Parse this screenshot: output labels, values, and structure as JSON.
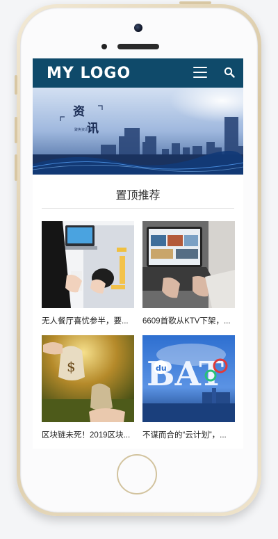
{
  "header": {
    "logo": "MY LOGO"
  },
  "banner": {
    "heading_chars": [
      "资",
      "讯"
    ],
    "subtext": "聚焦资讯热点"
  },
  "section": {
    "title": "置顶推荐"
  },
  "articles": [
    {
      "title": "无人餐厅喜忧参半，要..."
    },
    {
      "title": "6609首歌从KTV下架，..."
    },
    {
      "title": "区块链未死！2019区块..."
    },
    {
      "title": "不谋而合的“云计划”，..."
    }
  ],
  "colors": {
    "header_bg": "#0f4a6a",
    "accent": "#1f6fd6"
  }
}
